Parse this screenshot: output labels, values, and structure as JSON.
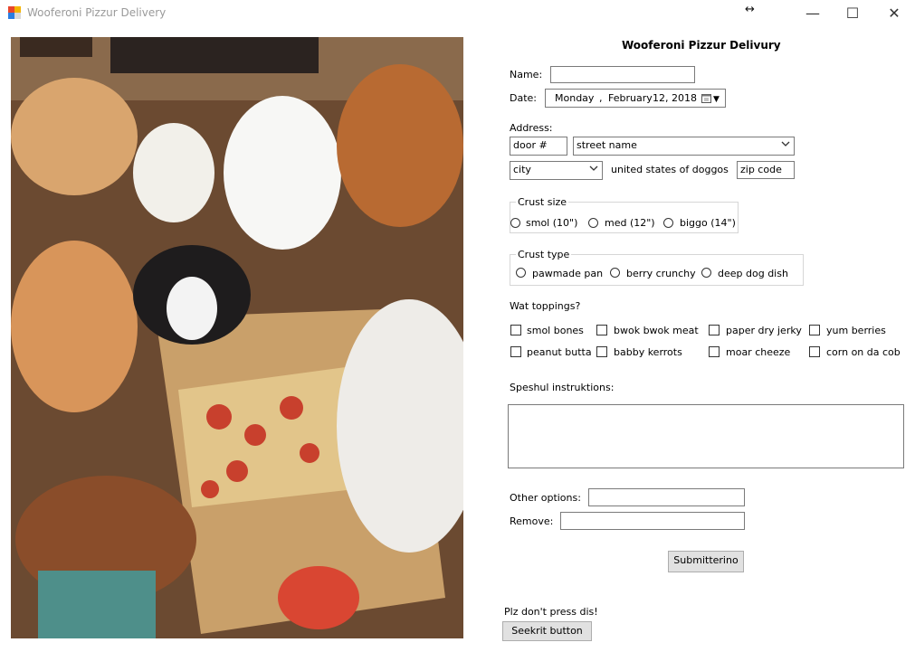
{
  "window": {
    "title": "Wooferoni Pizzur Delivery",
    "resize_glyph": "↔",
    "min_glyph": "—",
    "max_glyph": "☐",
    "close_glyph": "✕"
  },
  "form": {
    "title": "Wooferoni Pizzur Delivury",
    "name_label": "Name:",
    "name_value": "",
    "date_label": "Date:",
    "date": {
      "weekday": "Monday",
      "sep": ",",
      "month": "February",
      "day": "12, 2018",
      "dropdown_glyph": "▼"
    },
    "address_label": "Address:",
    "door_value": "door #",
    "street_value": "street name",
    "city_value": "city",
    "country_text": "united states of doggos",
    "zip_value": "zip code",
    "crust_size": {
      "title": "Crust size",
      "options": [
        "smol (10\")",
        "med (12\")",
        "biggo (14\")"
      ]
    },
    "crust_type": {
      "title": "Crust type",
      "options": [
        "pawmade pan",
        "berry crunchy",
        "deep dog dish"
      ]
    },
    "toppings_label": "Wat toppings?",
    "toppings": [
      "smol bones",
      "bwok bwok meat",
      "paper dry jerky",
      "yum berries",
      "peanut butta",
      "babby kerrots",
      "moar cheeze",
      "corn on da cob"
    ],
    "instructions_label": "Speshul instruktions:",
    "instructions_value": "",
    "other_options_label": "Other options:",
    "other_options_value": "",
    "remove_label": "Remove:",
    "remove_value": "",
    "submit_label": "Submitterino",
    "warning_text": "Plz don't press dis!",
    "secret_label": "Seekrit button"
  },
  "colors": {
    "title_text": "#9a9a9a",
    "border": "#7a7a7a",
    "button_bg": "#e1e1e1"
  }
}
